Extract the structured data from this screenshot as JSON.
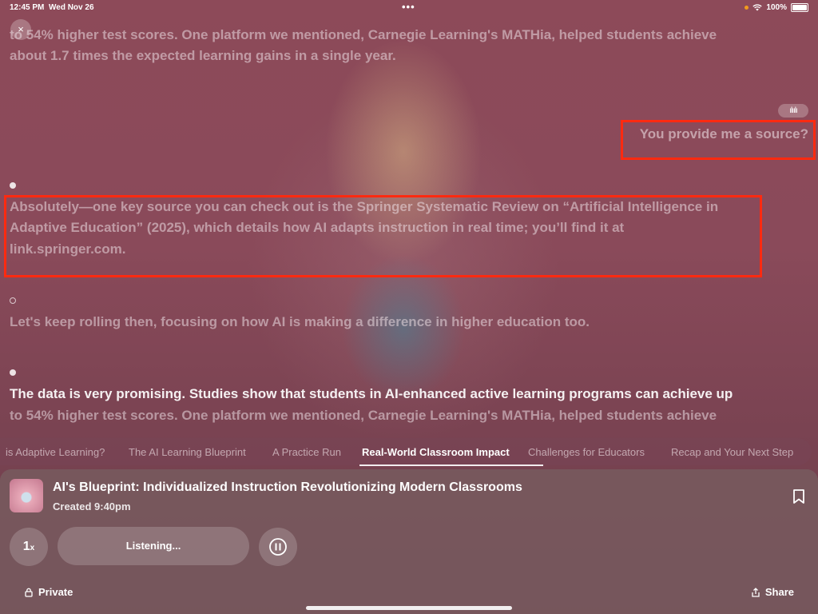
{
  "status_bar": {
    "time": "12:45 PM",
    "date": "Wed Nov 26",
    "battery": "100%",
    "more": "•••"
  },
  "close_icon": "×",
  "transcript": {
    "top_line_1": "to 54% higher test scores. One platform we mentioned, Carnegie Learning's MATHia, helped students achieve",
    "top_line_2": "about 1.7 times the expected learning gains in a single year.",
    "voice_icon": "ılıılı",
    "user_message": "You provide me a source?",
    "answer_line_1": "Absolutely—one key source you can check out is the Springer Systematic Review on “Artificial Intelligence in",
    "answer_line_2": "Adaptive Education” (2025), which details how AI adapts instruction in real time; you’ll find it at",
    "answer_line_3": "link.springer.com.",
    "next_line": "Let's keep rolling then, focusing on how AI is making a difference in higher education too.",
    "current_line_1": "The data is very promising. Studies show that students in AI-enhanced active learning programs can achieve up",
    "current_line_2": "to 54% higher test scores. One platform we mentioned, Carnegie Learning's MATHia, helped students achieve"
  },
  "chapters": [
    {
      "label": "is Adaptive Learning?"
    },
    {
      "label": "The AI Learning Blueprint"
    },
    {
      "label": "A Practice Run"
    },
    {
      "label": "Real-World Classroom Impact"
    },
    {
      "label": "Challenges for Educators"
    },
    {
      "label": "Recap and Your Next Step"
    }
  ],
  "player": {
    "title": "AI's Blueprint: Individualized Instruction Revolutionizing Modern Classrooms",
    "created": "Created 9:40pm",
    "speed": "1",
    "speed_unit": "x",
    "listening": "Listening...",
    "private_label": "Private",
    "share_label": "Share"
  },
  "colors": {
    "highlight_box": "#ff2a10",
    "background": "#8a4a5a"
  }
}
